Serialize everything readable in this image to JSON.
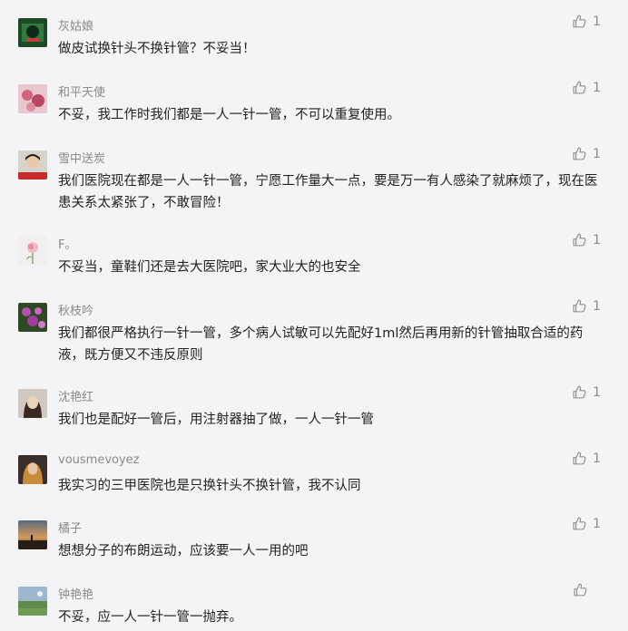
{
  "comments": [
    {
      "name": "灰姑娘",
      "text": "做皮试换针头不换针管？不妥当！",
      "likes": "1",
      "avatar": "dark-green-avatar"
    },
    {
      "name": "和平天使",
      "text": "不妥，我工作时我们都是一人一针一管，不可以重复使用。",
      "likes": "1",
      "avatar": "pink-flower-avatar"
    },
    {
      "name": "雪中送炭",
      "text": "我们医院现在都是一人一针一管，宁愿工作量大一点，要是万一有人感染了就麻烦了，现在医患关系太紧张了，不敢冒险！",
      "likes": "1",
      "avatar": "portrait-red-avatar"
    },
    {
      "name": "F。",
      "text": "不妥当，童鞋们还是去大医院吧，家大业大的也安全",
      "likes": "1",
      "avatar": "rose-avatar"
    },
    {
      "name": "秋枝吟",
      "text": "我们都很严格执行一针一管，多个病人试敏可以先配好1ml然后再用新的针管抽取合适的药液，既方便又不违反原则",
      "likes": "1",
      "avatar": "purple-flower-avatar"
    },
    {
      "name": "沈艳红",
      "text": "我们也是配好一管后，用注射器抽了做，一人一针一管",
      "likes": "1",
      "avatar": "portrait-avatar"
    },
    {
      "name": "vousmevoyez",
      "text": "我实习的三甲医院也是只换针头不换针管，我不认同",
      "likes": "1",
      "avatar": "portrait-dark-avatar"
    },
    {
      "name": "橘子",
      "text": "想想分子的布朗运动，应该要一人一用的吧",
      "likes": "1",
      "avatar": "sunset-avatar"
    },
    {
      "name": "钟艳艳",
      "text": "不妥，应一人一针一管一抛弃。",
      "likes": "",
      "avatar": "landscape-avatar"
    }
  ],
  "colors": {
    "background": "#f4f4f6",
    "text": "#222222",
    "meta": "#8a8a8a"
  },
  "icons": {
    "like": "thumbs-up-icon"
  }
}
